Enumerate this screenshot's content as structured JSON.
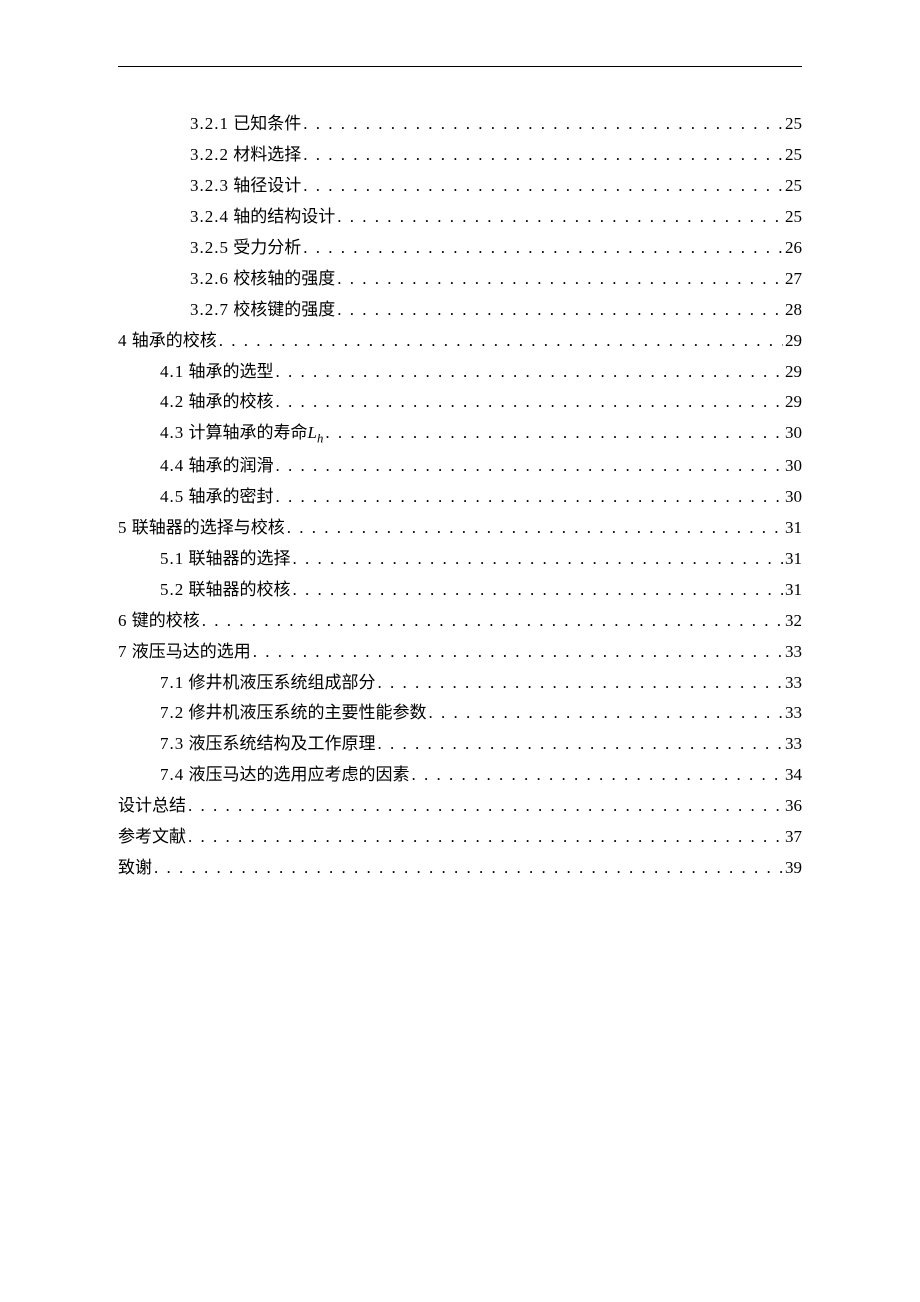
{
  "toc": [
    {
      "level": 2,
      "num": "3.2.1",
      "title": "已知条件",
      "page": "25"
    },
    {
      "level": 2,
      "num": "3.2.2",
      "title": "材料选择",
      "page": "25"
    },
    {
      "level": 2,
      "num": "3.2.3",
      "title": "轴径设计",
      "page": "25"
    },
    {
      "level": 2,
      "num": "3.2.4",
      "title": "轴的结构设计",
      "page": "25"
    },
    {
      "level": 2,
      "num": "3.2.5",
      "title": "受力分析",
      "page": "26"
    },
    {
      "level": 2,
      "num": "3.2.6",
      "title": "校核轴的强度",
      "page": "27"
    },
    {
      "level": 2,
      "num": "3.2.7",
      "title": "校核键的强度",
      "page": "28"
    },
    {
      "level": 0,
      "num": "4",
      "title": "轴承的校核",
      "page": "29"
    },
    {
      "level": 1,
      "num": "4.1",
      "title": "轴承的选型",
      "page": "29"
    },
    {
      "level": 1,
      "num": "4.2",
      "title": "轴承的校核",
      "page": "29"
    },
    {
      "level": 1,
      "num": "4.3",
      "title": "计算轴承的寿命",
      "suffix_html": "<span class=\"ital\">L<sub>h</sub></span>",
      "page": "30"
    },
    {
      "level": 1,
      "num": "4.4",
      "title": "轴承的润滑",
      "page": "30"
    },
    {
      "level": 1,
      "num": "4.5",
      "title": "轴承的密封",
      "page": "30"
    },
    {
      "level": 0,
      "num": "5",
      "title": "联轴器的选择与校核",
      "page": "31"
    },
    {
      "level": 1,
      "num": "5.1",
      "title": "联轴器的选择",
      "page": "31"
    },
    {
      "level": 1,
      "num": "5.2",
      "title": "联轴器的校核",
      "page": "31"
    },
    {
      "level": 0,
      "num": "6",
      "title": "键的校核",
      "page": "32"
    },
    {
      "level": 0,
      "num": "7",
      "title": "液压马达的选用",
      "page": "33"
    },
    {
      "level": 1,
      "num": "7.1",
      "title": "修井机液压系统组成部分",
      "page": "33"
    },
    {
      "level": 1,
      "num": "7.2",
      "title": "修井机液压系统的主要性能参数",
      "page": "33"
    },
    {
      "level": 1,
      "num": "7.3",
      "title": "液压系统结构及工作原理",
      "page": "33"
    },
    {
      "level": 1,
      "num": "7.4",
      "title": "液压马达的选用应考虑的因素",
      "page": "34"
    },
    {
      "level": 0,
      "num": "",
      "title": "设计总结",
      "page": "36"
    },
    {
      "level": 0,
      "num": "",
      "title": "参考文献",
      "page": "37"
    },
    {
      "level": 0,
      "num": "",
      "title": "致谢",
      "page": "39"
    }
  ]
}
